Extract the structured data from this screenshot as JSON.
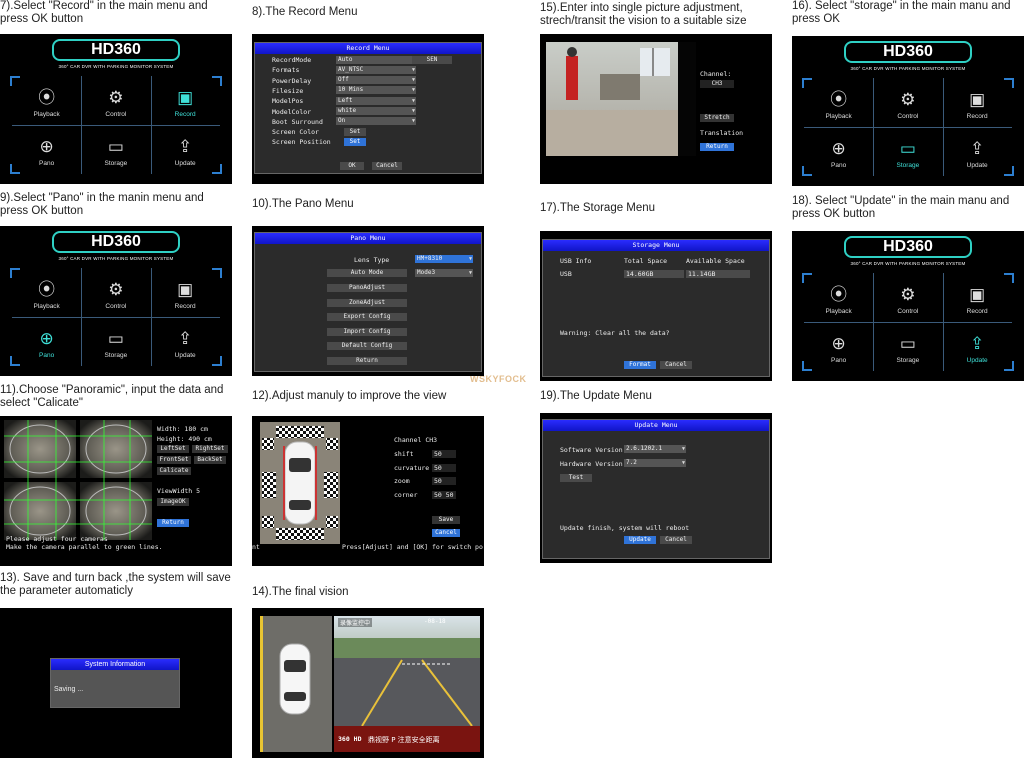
{
  "captions": {
    "c7": "7).Select \"Record\" in the main menu and press OK button",
    "c8": "8).The Record Menu",
    "c15": "15).Enter into single picture adjustment, strech/transit the vision to a suitable size",
    "c16": "16). Select \"storage\" in the main manu and press OK",
    "c9": "9).Select \"Pano\" in the manin menu and press OK button",
    "c10": "10).The Pano Menu",
    "c17": "17).The Storage Menu",
    "c18": "18). Select \"Update\" in the main manu and press OK button",
    "c11": "11).Choose \"Panoramic\", input the data and select \"Calicate\"",
    "c12": "12).Adjust manuly to improve the view",
    "c19": "19).The Update Menu",
    "c13": "13). Save and turn back ,the system will save the parameter automaticly",
    "c14": "14).The final vision"
  },
  "watermark": "WSKYFOCK",
  "main_menu": {
    "logo": "HD360",
    "subtitle": "360° CAR DVR WITH PARKING MONITOR SYSTEM",
    "tiles": [
      {
        "label": "Playback",
        "icon": "film-reel-icon"
      },
      {
        "label": "Control",
        "icon": "gear-icon"
      },
      {
        "label": "Record",
        "icon": "camera-icon"
      },
      {
        "label": "Pano",
        "icon": "globe-icon"
      },
      {
        "label": "Storage",
        "icon": "folder-icon"
      },
      {
        "label": "Update",
        "icon": "upload-icon"
      }
    ],
    "highlight_color": "#3fe0d8"
  },
  "record_menu": {
    "title": "Record Menu",
    "rows": [
      {
        "label": "RecordMode",
        "value": "Auto"
      },
      {
        "label": "Formats",
        "value": "AV_NTSC"
      },
      {
        "label": "PowerDelay",
        "value": "Off"
      },
      {
        "label": "Filesize",
        "value": "10 Mins"
      },
      {
        "label": "ModelPos",
        "value": "Left"
      },
      {
        "label": "ModelColor",
        "value": "white"
      },
      {
        "label": "Boot Surround",
        "value": "On"
      },
      {
        "label": "Screen Color",
        "value": "Set"
      },
      {
        "label": "Screen Position",
        "value": "Set"
      }
    ],
    "sen": "SEN",
    "ok": "OK",
    "cancel": "Cancel"
  },
  "pano_menu": {
    "title": "Pano Menu",
    "lens_label": "Lens Type",
    "lens_value": "HM+8310",
    "auto_label": "Auto Mode",
    "auto_value": "Mode3",
    "buttons": [
      "PanoAdjust",
      "ZoneAdjust",
      "Export Config",
      "Import Config",
      "Default Config",
      "Return"
    ]
  },
  "calib": {
    "width_label": "Width:",
    "width": "180",
    "width_unit": "cm",
    "height_label": "Height:",
    "height": "490",
    "height_unit": "cm",
    "left": "LeftSet",
    "right": "RightSet",
    "front": "FrontSet",
    "back": "BackSet",
    "calc": "Calicate",
    "view_label": "ViewWidth",
    "view_value": "5",
    "image": "ImageOK",
    "return": "Return",
    "msg1": "Please adjust four cameras",
    "msg2": "Make the camera parallel to green lines."
  },
  "adjust": {
    "channel_label": "Channel",
    "channel": "CH3",
    "fields": [
      {
        "label": "shift",
        "value": "50"
      },
      {
        "label": "curvature",
        "value": "50"
      },
      {
        "label": "zoom",
        "value": "50"
      },
      {
        "label": "corner",
        "value": "50 50"
      }
    ],
    "save": "Save",
    "cancel": "Cancel",
    "hint_left": "nt",
    "hint": "Press[Adjust] and [OK] for switch po"
  },
  "saving": {
    "title": "System Information",
    "text": "Saving ..."
  },
  "final": {
    "overlay": "录像监控中",
    "time": "-08-18",
    "brand": "鼎视野 P 注意安全距离",
    "badge": "360 HD"
  },
  "single": {
    "channel_label": "Channel:",
    "channel": "CH3",
    "stretch": "Stretch",
    "translation": "Translation",
    "return": "Return"
  },
  "storage_menu": {
    "title": "Storage  Menu",
    "headers": [
      "USB Info",
      "Total Space",
      "Available Space"
    ],
    "row": [
      "USB",
      "14.60GB",
      "11.14GB"
    ],
    "warning": "Warning: Clear all the data?",
    "format": "Format",
    "cancel": "Cancel"
  },
  "update_menu": {
    "title": "Update  Menu",
    "sw_label": "Software Version",
    "sw": "2.6.1202.1",
    "hw_label": "Hardware Version",
    "hw": "7.2",
    "test": "Test",
    "msg": "Update finish, system will reboot",
    "update": "Update",
    "cancel": "Cancel"
  }
}
